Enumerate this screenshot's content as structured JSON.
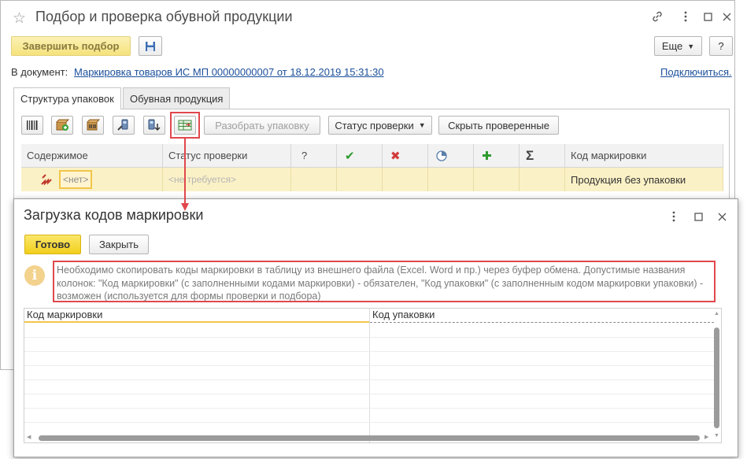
{
  "main": {
    "title": "Подбор и проверка обувной продукции",
    "finish_button": "Завершить подбор",
    "more_button": "Еще",
    "help_button": "?",
    "document_label": "В документ:",
    "document_link": "Маркировка товаров ИС МП 00000000007 от 18.12.2019 15:31:30",
    "connect_link": "Подключиться.",
    "tabs": [
      {
        "label": "Структура упаковок"
      },
      {
        "label": "Обувная продукция"
      }
    ],
    "toolbar": {
      "unpack_button": "Разобрать упаковку",
      "check_status_button": "Статус проверки",
      "hide_checked_button": "Скрыть проверенные"
    },
    "grid": {
      "headers": {
        "content": "Содержимое",
        "status": "Статус проверки",
        "question": "?",
        "check": "✔",
        "cross": "✖",
        "sum": "Σ",
        "code": "Код маркировки"
      },
      "row": {
        "content": "<нет>",
        "status": "<не требуется>",
        "code": "Продукция без упаковки"
      }
    }
  },
  "dialog": {
    "title": "Загрузка кодов маркировки",
    "ok_button": "Готово",
    "close_button": "Закрыть",
    "info_icon": "i",
    "info_text": "Необходимо скопировать коды маркировки в таблицу из внешнего файла (Excel. Word и пр.) через буфер обмена. Допустимые названия колонок: \"Код маркировки\" (с заполненными кодами маркировки) - обязателен, \"Код упаковки\" (с заполненным кодом маркировки упаковки) - возможен (используется для формы проверки и подбора)",
    "table_headers": {
      "code": "Код маркировки",
      "package_code": "Код упаковки"
    }
  },
  "colors": {
    "accent_yellow": "#f2cf1c",
    "highlight_red": "#e0474c",
    "selected_row": "#fbf1c6",
    "link": "#1b4f9b"
  }
}
